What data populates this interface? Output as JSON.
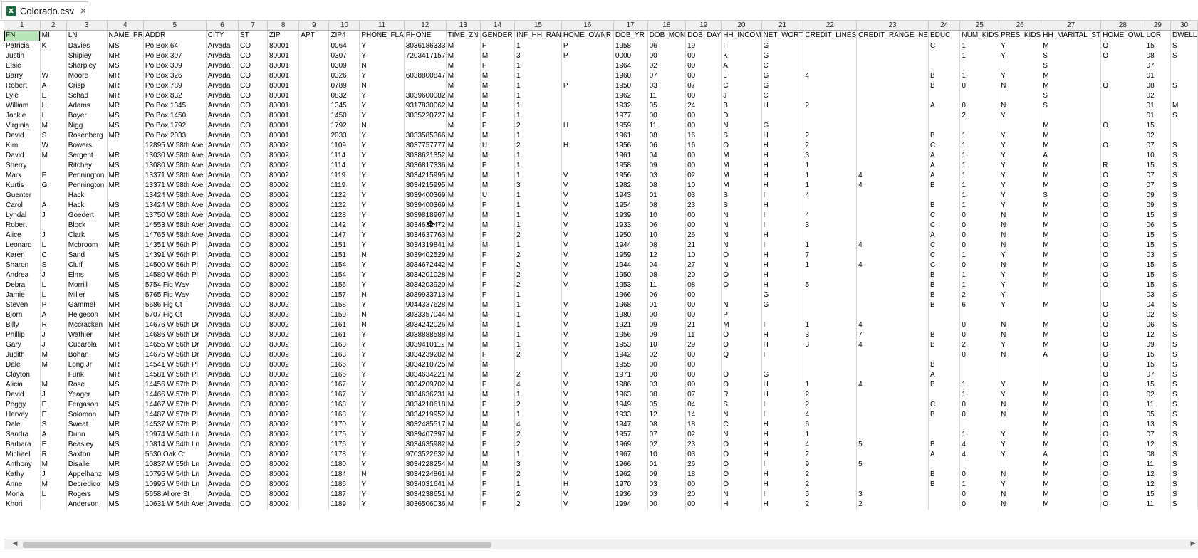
{
  "tab": {
    "title": "Colorado.csv",
    "icon": "excel-file-icon",
    "close_glyph": "×"
  },
  "columns": [
    "1",
    "2",
    "3",
    "4",
    "5",
    "6",
    "7",
    "8",
    "9",
    "10",
    "11",
    "12",
    "13",
    "14",
    "15",
    "16",
    "17",
    "18",
    "19",
    "20",
    "21",
    "22",
    "23",
    "24",
    "25",
    "26",
    "27",
    "28",
    "29",
    "30"
  ],
  "rows": [
    [
      "FN",
      "MI",
      "LN",
      "NAME_PR",
      "ADDR",
      "CITY",
      "ST",
      "ZIP",
      "APT",
      "ZIP4",
      "PHONE_FLA",
      "PHONE",
      "TIME_ZN",
      "GENDER",
      "INF_HH_RAN",
      "HOME_OWNR",
      "DOB_YR",
      "DOB_MON",
      "DOB_DAY",
      "HH_INCOM",
      "NET_WORT",
      "CREDIT_LINES",
      "CREDIT_RANGE_NE",
      "EDUC",
      "NUM_KIDS",
      "PRES_KIDS",
      "HH_MARITAL_ST",
      "HOME_OWL",
      "LOR",
      "DWELL"
    ],
    [
      "Patricia",
      "K",
      "Davies",
      "MS",
      "Po Box 64",
      "Arvada",
      "CO",
      "80001",
      "",
      "0064",
      "Y",
      "3036186333",
      "M",
      "F",
      "1",
      "P",
      "1958",
      "06",
      "19",
      "I",
      "G",
      "",
      "",
      "C",
      "1",
      "Y",
      "M",
      "O",
      "15",
      "S"
    ],
    [
      "Justin",
      "",
      "Shipley",
      "MR",
      "Po Box 307",
      "Arvada",
      "CO",
      "80001",
      "",
      "0307",
      "Y",
      "7203417157",
      "M",
      "M",
      "3",
      "P",
      "0000",
      "00",
      "00",
      "K",
      "G",
      "",
      "",
      "",
      "1",
      "Y",
      "S",
      "O",
      "08",
      "S"
    ],
    [
      "Elsie",
      "",
      "Sharpley",
      "MS",
      "Po Box 309",
      "Arvada",
      "CO",
      "80001",
      "",
      "0309",
      "N",
      "",
      "M",
      "F",
      "1",
      "",
      "1964",
      "02",
      "00",
      "A",
      "C",
      "",
      "",
      "",
      "",
      "",
      "S",
      "",
      "07",
      ""
    ],
    [
      "Barry",
      "W",
      "Moore",
      "MR",
      "Po Box 326",
      "Arvada",
      "CO",
      "80001",
      "",
      "0326",
      "Y",
      "6038800847",
      "M",
      "M",
      "1",
      "",
      "1960",
      "07",
      "00",
      "L",
      "G",
      "4",
      "",
      "B",
      "1",
      "Y",
      "M",
      "",
      "01",
      ""
    ],
    [
      "Robert",
      "A",
      "Crisp",
      "MR",
      "Po Box 789",
      "Arvada",
      "CO",
      "80001",
      "",
      "0789",
      "N",
      "",
      "M",
      "M",
      "1",
      "P",
      "1950",
      "03",
      "07",
      "C",
      "G",
      "",
      "",
      "B",
      "0",
      "N",
      "M",
      "O",
      "08",
      "S"
    ],
    [
      "Lyle",
      "E",
      "Schad",
      "MR",
      "Po Box 832",
      "Arvada",
      "CO",
      "80001",
      "",
      "0832",
      "Y",
      "3039600082",
      "M",
      "M",
      "1",
      "",
      "1962",
      "11",
      "00",
      "J",
      "C",
      "",
      "",
      "",
      "",
      "",
      "S",
      "",
      "02",
      ""
    ],
    [
      "William",
      "H",
      "Adams",
      "MR",
      "Po Box 1345",
      "Arvada",
      "CO",
      "80001",
      "",
      "1345",
      "Y",
      "9317830062",
      "M",
      "M",
      "1",
      "",
      "1932",
      "05",
      "24",
      "B",
      "H",
      "2",
      "",
      "A",
      "0",
      "N",
      "S",
      "",
      "01",
      "M"
    ],
    [
      "Jackie",
      "L",
      "Boyer",
      "MS",
      "Po Box 1450",
      "Arvada",
      "CO",
      "80001",
      "",
      "1450",
      "Y",
      "3035220727",
      "M",
      "F",
      "1",
      "",
      "1977",
      "00",
      "00",
      "D",
      "",
      "",
      "",
      "",
      "2",
      "Y",
      "",
      "",
      "01",
      "S"
    ],
    [
      "Virginia",
      "M",
      "Nigg",
      "MS",
      "Po Box 1792",
      "Arvada",
      "CO",
      "80001",
      "",
      "1792",
      "N",
      "",
      "M",
      "F",
      "2",
      "H",
      "1959",
      "11",
      "00",
      "N",
      "G",
      "",
      "",
      "",
      "",
      "",
      "M",
      "O",
      "15",
      ""
    ],
    [
      "David",
      "S",
      "Rosenberg",
      "MR",
      "Po Box 2033",
      "Arvada",
      "CO",
      "80001",
      "",
      "2033",
      "Y",
      "3033585366",
      "M",
      "M",
      "1",
      "",
      "1961",
      "08",
      "16",
      "S",
      "H",
      "2",
      "",
      "B",
      "1",
      "Y",
      "M",
      "",
      "02",
      ""
    ],
    [
      "Kim",
      "W",
      "Bowers",
      "",
      "12895 W 58th Ave",
      "Arvada",
      "CO",
      "80002",
      "",
      "1109",
      "Y",
      "3037757777",
      "M",
      "U",
      "2",
      "H",
      "1956",
      "06",
      "16",
      "O",
      "H",
      "2",
      "",
      "C",
      "1",
      "Y",
      "M",
      "O",
      "07",
      "S"
    ],
    [
      "David",
      "M",
      "Sergent",
      "MR",
      "13030 W 58th Ave",
      "Arvada",
      "CO",
      "80002",
      "",
      "1114",
      "Y",
      "3038621352",
      "M",
      "M",
      "1",
      "",
      "1961",
      "04",
      "00",
      "M",
      "H",
      "3",
      "",
      "A",
      "1",
      "Y",
      "A",
      "",
      "10",
      "S"
    ],
    [
      "Sherry",
      "",
      "Ritchey",
      "MS",
      "13080 W 58th Ave",
      "Arvada",
      "CO",
      "80002",
      "",
      "1114",
      "Y",
      "3036817336",
      "M",
      "F",
      "1",
      "",
      "1958",
      "09",
      "00",
      "M",
      "H",
      "1",
      "",
      "A",
      "1",
      "Y",
      "M",
      "R",
      "15",
      "S"
    ],
    [
      "Mark",
      "F",
      "Pennington",
      "MR",
      "13371 W 58th Ave",
      "Arvada",
      "CO",
      "80002",
      "",
      "1119",
      "Y",
      "3034215995",
      "M",
      "M",
      "1",
      "V",
      "1956",
      "03",
      "02",
      "M",
      "H",
      "1",
      "4",
      "A",
      "1",
      "Y",
      "M",
      "O",
      "07",
      "S"
    ],
    [
      "Kurtis",
      "G",
      "Pennington",
      "MR",
      "13371 W 58th Ave",
      "Arvada",
      "CO",
      "80002",
      "",
      "1119",
      "Y",
      "3034215995",
      "M",
      "M",
      "3",
      "V",
      "1982",
      "08",
      "10",
      "M",
      "H",
      "1",
      "4",
      "B",
      "1",
      "Y",
      "M",
      "O",
      "07",
      "S"
    ],
    [
      "Guenter",
      "",
      "Hackl",
      "",
      "13424 W 58th Ave",
      "Arvada",
      "CO",
      "80002",
      "",
      "1122",
      "Y",
      "3039400369",
      "M",
      "U",
      "1",
      "V",
      "1943",
      "01",
      "03",
      "S",
      "I",
      "4",
      "",
      "",
      "1",
      "Y",
      "S",
      "O",
      "09",
      "S"
    ],
    [
      "Carol",
      "A",
      "Hackl",
      "MS",
      "13424 W 58th Ave",
      "Arvada",
      "CO",
      "80002",
      "",
      "1122",
      "Y",
      "3039400369",
      "M",
      "F",
      "1",
      "V",
      "1954",
      "08",
      "23",
      "S",
      "H",
      "",
      "",
      "B",
      "1",
      "Y",
      "M",
      "O",
      "09",
      "S"
    ],
    [
      "Lyndal",
      "J",
      "Goedert",
      "MR",
      "13750 W 58th Ave",
      "Arvada",
      "CO",
      "80002",
      "",
      "1128",
      "Y",
      "3039818967",
      "M",
      "M",
      "1",
      "V",
      "1939",
      "10",
      "00",
      "N",
      "I",
      "4",
      "",
      "C",
      "0",
      "N",
      "M",
      "O",
      "15",
      "S"
    ],
    [
      "Robert",
      "",
      "Block",
      "MR",
      "14553 W 58th Ave",
      "Arvada",
      "CO",
      "80002",
      "",
      "1142",
      "Y",
      "3034631472",
      "M",
      "M",
      "1",
      "V",
      "1933",
      "06",
      "00",
      "N",
      "I",
      "3",
      "",
      "C",
      "0",
      "N",
      "M",
      "O",
      "06",
      "S"
    ],
    [
      "Alice",
      "J",
      "Clark",
      "MS",
      "14765 W 58th Ave",
      "Arvada",
      "CO",
      "80002",
      "",
      "1147",
      "Y",
      "3034637763",
      "M",
      "F",
      "2",
      "V",
      "1950",
      "10",
      "26",
      "N",
      "H",
      "",
      "",
      "A",
      "0",
      "N",
      "M",
      "O",
      "15",
      "S"
    ],
    [
      "Leonard",
      "L",
      "Mcbroom",
      "MR",
      "14351 W 56th Pl",
      "Arvada",
      "CO",
      "80002",
      "",
      "1151",
      "Y",
      "3034319841",
      "M",
      "M",
      "1",
      "V",
      "1944",
      "08",
      "21",
      "N",
      "I",
      "1",
      "4",
      "C",
      "0",
      "N",
      "M",
      "O",
      "15",
      "S"
    ],
    [
      "Karen",
      "C",
      "Sand",
      "MS",
      "14391 W 56th Pl",
      "Arvada",
      "CO",
      "80002",
      "",
      "1151",
      "N",
      "3039402529",
      "M",
      "F",
      "2",
      "V",
      "1959",
      "12",
      "10",
      "O",
      "H",
      "7",
      "",
      "C",
      "1",
      "Y",
      "M",
      "O",
      "03",
      "S"
    ],
    [
      "Sharon",
      "S",
      "Cluff",
      "MS",
      "14500 W 56th Pl",
      "Arvada",
      "CO",
      "80002",
      "",
      "1154",
      "Y",
      "3034672442",
      "M",
      "F",
      "2",
      "V",
      "1944",
      "04",
      "27",
      "N",
      "H",
      "1",
      "4",
      "C",
      "0",
      "N",
      "M",
      "O",
      "15",
      "S"
    ],
    [
      "Andrea",
      "J",
      "Elms",
      "MS",
      "14580 W 56th Pl",
      "Arvada",
      "CO",
      "80002",
      "",
      "1154",
      "Y",
      "3034201028",
      "M",
      "F",
      "2",
      "V",
      "1950",
      "08",
      "20",
      "O",
      "H",
      "",
      "",
      "B",
      "1",
      "Y",
      "M",
      "O",
      "15",
      "S"
    ],
    [
      "Debra",
      "L",
      "Morrill",
      "MS",
      "5754 Fig Way",
      "Arvada",
      "CO",
      "80002",
      "",
      "1156",
      "Y",
      "3034203920",
      "M",
      "F",
      "2",
      "V",
      "1953",
      "11",
      "08",
      "O",
      "H",
      "5",
      "",
      "B",
      "1",
      "Y",
      "M",
      "O",
      "15",
      "S"
    ],
    [
      "Jamie",
      "L",
      "Miller",
      "MS",
      "5765 Fig Way",
      "Arvada",
      "CO",
      "80002",
      "",
      "1157",
      "N",
      "3039933713",
      "M",
      "F",
      "1",
      "",
      "1966",
      "06",
      "00",
      "",
      "G",
      "",
      "",
      "B",
      "2",
      "Y",
      "",
      "",
      "03",
      "S"
    ],
    [
      "Steven",
      "P",
      "Gammel",
      "MR",
      "5686 Fig Ct",
      "Arvada",
      "CO",
      "80002",
      "",
      "1158",
      "Y",
      "9044337628",
      "M",
      "M",
      "1",
      "V",
      "1968",
      "01",
      "00",
      "N",
      "G",
      "",
      "",
      "B",
      "6",
      "Y",
      "M",
      "O",
      "04",
      "S"
    ],
    [
      "Bjorn",
      "A",
      "Helgeson",
      "MR",
      "5707 Fig Ct",
      "Arvada",
      "CO",
      "80002",
      "",
      "1159",
      "N",
      "3033357044",
      "M",
      "M",
      "1",
      "V",
      "1980",
      "00",
      "00",
      "P",
      "",
      "",
      "",
      "",
      "",
      "",
      "",
      "O",
      "02",
      "S"
    ],
    [
      "Billy",
      "R",
      "Mccracken",
      "MR",
      "14676 W 56th Dr",
      "Arvada",
      "CO",
      "80002",
      "",
      "1161",
      "N",
      "3034242026",
      "M",
      "M",
      "1",
      "V",
      "1921",
      "09",
      "21",
      "M",
      "I",
      "1",
      "4",
      "",
      "0",
      "N",
      "M",
      "O",
      "06",
      "S"
    ],
    [
      "Phillip",
      "J",
      "Wathier",
      "MR",
      "14686 W 56th Dr",
      "Arvada",
      "CO",
      "80002",
      "",
      "1161",
      "Y",
      "3038888588",
      "M",
      "M",
      "1",
      "V",
      "1956",
      "09",
      "11",
      "O",
      "H",
      "3",
      "7",
      "B",
      "0",
      "N",
      "M",
      "O",
      "12",
      "S"
    ],
    [
      "Gary",
      "J",
      "Cucarola",
      "MR",
      "14655 W 56th Dr",
      "Arvada",
      "CO",
      "80002",
      "",
      "1163",
      "Y",
      "3039410112",
      "M",
      "M",
      "1",
      "V",
      "1953",
      "10",
      "29",
      "O",
      "H",
      "3",
      "4",
      "B",
      "2",
      "Y",
      "M",
      "O",
      "09",
      "S"
    ],
    [
      "Judith",
      "M",
      "Bohan",
      "MS",
      "14675 W 56th Dr",
      "Arvada",
      "CO",
      "80002",
      "",
      "1163",
      "Y",
      "3034239282",
      "M",
      "F",
      "2",
      "V",
      "1942",
      "02",
      "00",
      "Q",
      "I",
      "",
      "",
      "",
      "0",
      "N",
      "A",
      "O",
      "15",
      "S"
    ],
    [
      "Dale",
      "M",
      "Long Jr",
      "MR",
      "14541 W 56th Pl",
      "Arvada",
      "CO",
      "80002",
      "",
      "1166",
      "Y",
      "3034210725",
      "M",
      "M",
      "",
      "",
      "1955",
      "00",
      "00",
      "",
      "",
      "",
      "",
      "B",
      "",
      "",
      "",
      "O",
      "15",
      "S"
    ],
    [
      "Clayton",
      "",
      "Funk",
      "MR",
      "14581 W 56th Pl",
      "Arvada",
      "CO",
      "80002",
      "",
      "1166",
      "Y",
      "3034634221",
      "M",
      "M",
      "2",
      "V",
      "1971",
      "00",
      "00",
      "O",
      "G",
      "",
      "",
      "A",
      "",
      "",
      "",
      "O",
      "07",
      "S"
    ],
    [
      "Alicia",
      "M",
      "Rose",
      "MS",
      "14456 W 57th Pl",
      "Arvada",
      "CO",
      "80002",
      "",
      "1167",
      "Y",
      "3034209702",
      "M",
      "F",
      "4",
      "V",
      "1986",
      "03",
      "00",
      "O",
      "H",
      "1",
      "4",
      "B",
      "1",
      "Y",
      "M",
      "O",
      "15",
      "S"
    ],
    [
      "David",
      "J",
      "Yeager",
      "MR",
      "14466 W 57th Pl",
      "Arvada",
      "CO",
      "80002",
      "",
      "1167",
      "Y",
      "3034636231",
      "M",
      "M",
      "1",
      "V",
      "1963",
      "08",
      "07",
      "R",
      "H",
      "2",
      "",
      "",
      "1",
      "Y",
      "M",
      "O",
      "02",
      "S"
    ],
    [
      "Peggy",
      "E",
      "Fergason",
      "MS",
      "14467 W 57th Pl",
      "Arvada",
      "CO",
      "80002",
      "",
      "1168",
      "Y",
      "3034210618",
      "M",
      "F",
      "2",
      "V",
      "1949",
      "05",
      "04",
      "S",
      "I",
      "2",
      "",
      "C",
      "0",
      "N",
      "M",
      "O",
      "11",
      "S"
    ],
    [
      "Harvey",
      "E",
      "Solomon",
      "MR",
      "14487 W 57th Pl",
      "Arvada",
      "CO",
      "80002",
      "",
      "1168",
      "Y",
      "3034219952",
      "M",
      "M",
      "1",
      "V",
      "1933",
      "12",
      "14",
      "N",
      "I",
      "4",
      "",
      "B",
      "0",
      "N",
      "M",
      "O",
      "05",
      "S"
    ],
    [
      "Dale",
      "S",
      "Sweat",
      "MR",
      "14537 W 57th Pl",
      "Arvada",
      "CO",
      "80002",
      "",
      "1170",
      "Y",
      "3032485517",
      "M",
      "M",
      "4",
      "V",
      "1947",
      "08",
      "18",
      "C",
      "H",
      "6",
      "",
      "",
      "",
      "",
      "M",
      "O",
      "13",
      "S"
    ],
    [
      "Sandra",
      "A",
      "Dunn",
      "MS",
      "10974 W 54th Ln",
      "Arvada",
      "CO",
      "80002",
      "",
      "1175",
      "Y",
      "3039407397",
      "M",
      "F",
      "2",
      "V",
      "1957",
      "07",
      "02",
      "N",
      "H",
      "1",
      "",
      "",
      "1",
      "Y",
      "M",
      "O",
      "07",
      "S"
    ],
    [
      "Barbara",
      "E",
      "Beasley",
      "MS",
      "10814 W 54th Ln",
      "Arvada",
      "CO",
      "80002",
      "",
      "1176",
      "Y",
      "3034635982",
      "M",
      "F",
      "2",
      "V",
      "1969",
      "02",
      "23",
      "O",
      "H",
      "4",
      "5",
      "B",
      "4",
      "Y",
      "M",
      "O",
      "12",
      "S"
    ],
    [
      "Michael",
      "R",
      "Saxton",
      "MR",
      "5530 Oak Ct",
      "Arvada",
      "CO",
      "80002",
      "",
      "1178",
      "Y",
      "9703522632",
      "M",
      "M",
      "1",
      "V",
      "1967",
      "10",
      "03",
      "O",
      "H",
      "2",
      "",
      "A",
      "4",
      "Y",
      "A",
      "O",
      "08",
      "S"
    ],
    [
      "Anthony",
      "M",
      "Disalle",
      "MR",
      "10837 W 55th Ln",
      "Arvada",
      "CO",
      "80002",
      "",
      "1180",
      "Y",
      "3034228254",
      "M",
      "M",
      "3",
      "V",
      "1966",
      "01",
      "26",
      "O",
      "I",
      "9",
      "5",
      "",
      "",
      "",
      "M",
      "O",
      "11",
      "S"
    ],
    [
      "Kathy",
      "J",
      "Appelhanz",
      "MS",
      "10795 W 54th Ln",
      "Arvada",
      "CO",
      "80002",
      "",
      "1184",
      "N",
      "3034224861",
      "M",
      "F",
      "2",
      "V",
      "1962",
      "09",
      "18",
      "O",
      "H",
      "2",
      "",
      "B",
      "0",
      "N",
      "M",
      "O",
      "12",
      "S"
    ],
    [
      "Anne",
      "M",
      "Decredico",
      "MS",
      "10995 W 54th Ln",
      "Arvada",
      "CO",
      "80002",
      "",
      "1186",
      "Y",
      "3034031641",
      "M",
      "F",
      "1",
      "H",
      "1970",
      "03",
      "00",
      "O",
      "H",
      "2",
      "",
      "B",
      "1",
      "Y",
      "M",
      "O",
      "12",
      "S"
    ],
    [
      "Mona",
      "L",
      "Rogers",
      "MS",
      "5658 Allore St",
      "Arvada",
      "CO",
      "80002",
      "",
      "1187",
      "Y",
      "3034238651",
      "M",
      "F",
      "2",
      "V",
      "1936",
      "03",
      "20",
      "N",
      "I",
      "5",
      "3",
      "",
      "0",
      "N",
      "M",
      "O",
      "15",
      "S"
    ],
    [
      "Khori",
      "",
      "Anderson",
      "MS",
      "10631 W 54th Ave",
      "Arvada",
      "CO",
      "80002",
      "",
      "1189",
      "Y",
      "3036506036",
      "M",
      "F",
      "2",
      "V",
      "1994",
      "00",
      "00",
      "H",
      "H",
      "2",
      "2",
      "",
      "0",
      "N",
      "M",
      "O",
      "11",
      "S"
    ]
  ]
}
